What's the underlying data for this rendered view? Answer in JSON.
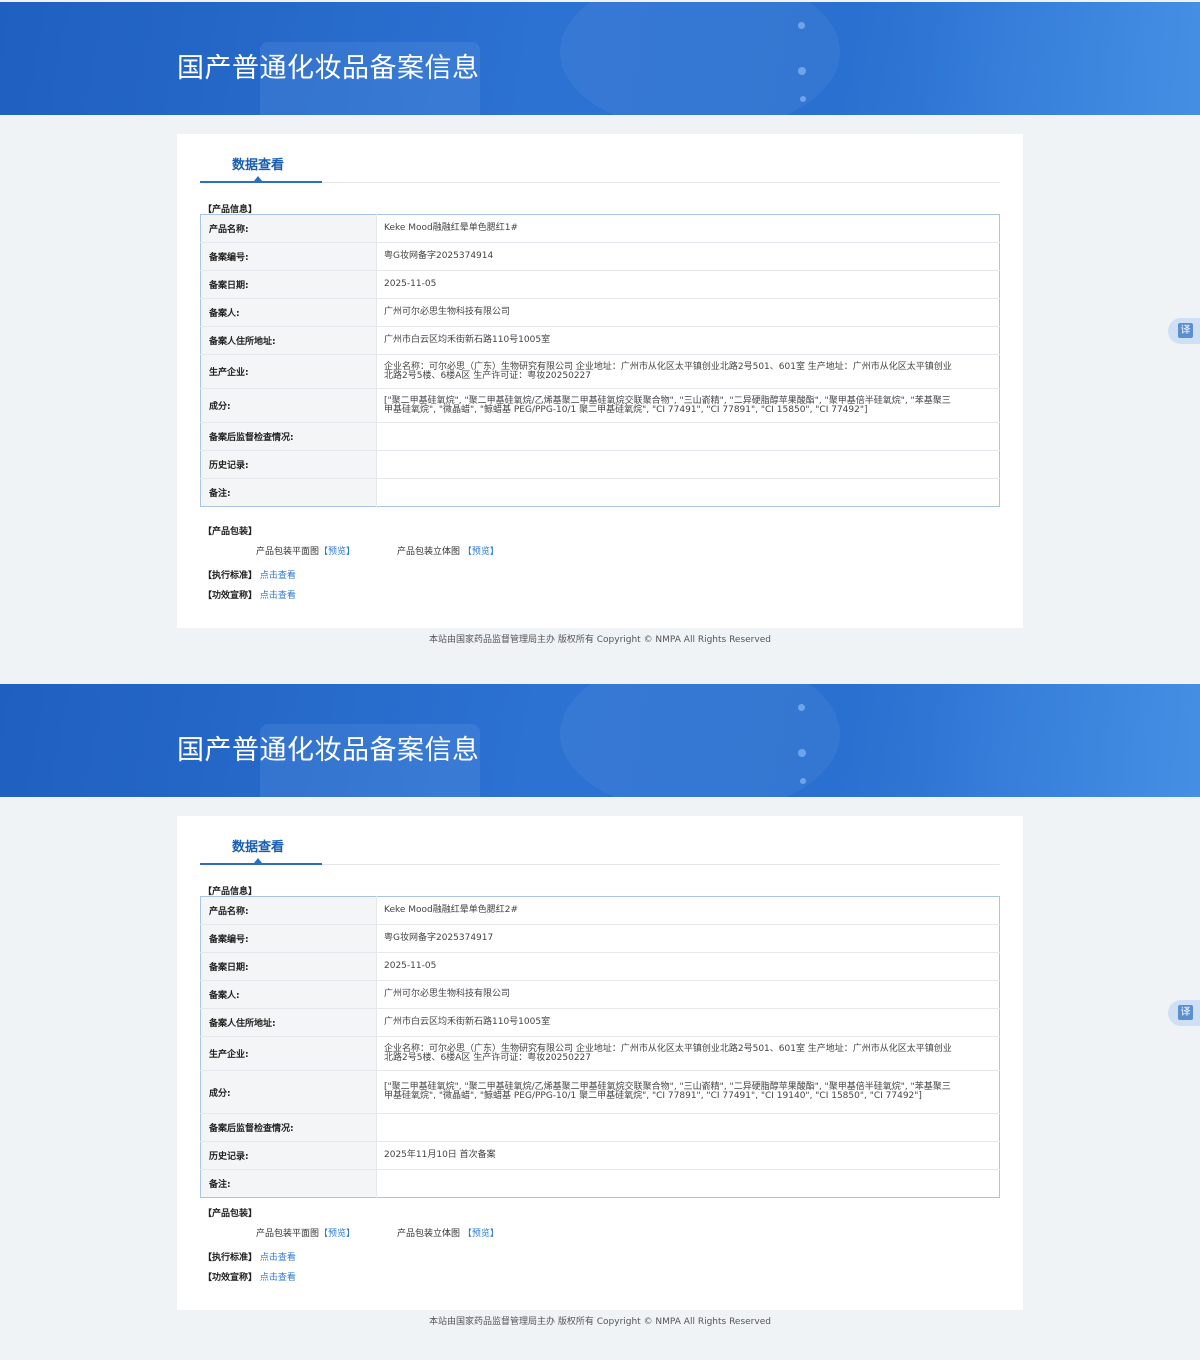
{
  "records": [
    {
      "banner_title": "国产普通化妆品备案信息",
      "tab_label": "数据查看",
      "section_product_info": "【产品信息】",
      "fields": [
        {
          "key": "产品名称:",
          "value": "Keke Mood融融红晕单色腮红1#"
        },
        {
          "key": "备案编号:",
          "value": "粤G妆网备字2025374914"
        },
        {
          "key": "备案日期:",
          "value": "2025-11-05"
        },
        {
          "key": "备案人:",
          "value": "广州可尔必思生物科技有限公司"
        },
        {
          "key": "备案人住所地址:",
          "value": "广州市白云区均禾街新石路110号1005室"
        },
        {
          "key": "生产企业:",
          "value": "企业名称：可尔必思（广东）生物研究有限公司 企业地址：广州市从化区太平镇创业北路2号501、601室 生产地址：广州市从化区太平镇创业北路2号5楼、6楼A区 生产许可证：粤妆20250227"
        },
        {
          "key": "成分:",
          "value": "[\"聚二甲基硅氧烷\", \"聚二甲基硅氧烷/乙烯基聚二甲基硅氧烷交联聚合物\", \"三山嵛精\", \"二异硬脂醇苹果酸酯\", \"聚甲基倍半硅氧烷\", \"苯基聚三甲基硅氧烷\", \"微晶蜡\", \"鲸蜡基 PEG/PPG-10/1 聚二甲基硅氧烷\", \"CI 77491\", \"CI 77891\", \"CI 15850\", \"CI 77492\"]"
        },
        {
          "key": "备案后监督检查情况:",
          "value": ""
        },
        {
          "key": "历史记录:",
          "value": ""
        },
        {
          "key": "备注:",
          "value": ""
        }
      ],
      "section_packaging": "【产品包装】",
      "pkg_flat_label": "产品包装平面图",
      "pkg_flat_link": "【预览】",
      "pkg_3d_label": "产品包装立体图",
      "pkg_3d_link": "【预览】",
      "standard_label": "【执行标准】",
      "standard_link": "点击查看",
      "efficacy_label": "【功效宣称】",
      "efficacy_link": "点击查看",
      "copyright": "本站由国家药品监督管理局主办 版权所有 Copyright © NMPA All Rights Reserved",
      "translate_icon": "译"
    },
    {
      "banner_title": "国产普通化妆品备案信息",
      "tab_label": "数据查看",
      "section_product_info": "【产品信息】",
      "fields": [
        {
          "key": "产品名称:",
          "value": "Keke Mood融融红晕单色腮红2#"
        },
        {
          "key": "备案编号:",
          "value": "粤G妆网备字2025374917"
        },
        {
          "key": "备案日期:",
          "value": "2025-11-05"
        },
        {
          "key": "备案人:",
          "value": "广州可尔必思生物科技有限公司"
        },
        {
          "key": "备案人住所地址:",
          "value": "广州市白云区均禾街新石路110号1005室"
        },
        {
          "key": "生产企业:",
          "value": "企业名称：可尔必思（广东）生物研究有限公司 企业地址：广州市从化区太平镇创业北路2号501、601室 生产地址：广州市从化区太平镇创业北路2号5楼、6楼A区 生产许可证：粤妆20250227"
        },
        {
          "key": "成分:",
          "value": "[\"聚二甲基硅氧烷\", \"聚二甲基硅氧烷/乙烯基聚二甲基硅氧烷交联聚合物\", \"三山嵛精\", \"二异硬脂醇苹果酸酯\", \"聚甲基倍半硅氧烷\", \"苯基聚三甲基硅氧烷\", \"微晶蜡\", \"鲸蜡基 PEG/PPG-10/1 聚二甲基硅氧烷\", \"CI 77891\", \"CI 77491\", \"CI 19140\", \"CI 15850\", \"CI 77492\"]"
        },
        {
          "key": "备案后监督检查情况:",
          "value": ""
        },
        {
          "key": "历史记录:",
          "value": "2025年11月10日 首次备案"
        },
        {
          "key": "备注:",
          "value": ""
        }
      ],
      "section_packaging": "【产品包装】",
      "pkg_flat_label": "产品包装平面图",
      "pkg_flat_link": "【预览】",
      "pkg_3d_label": "产品包装立体图",
      "pkg_3d_link": "【预览】",
      "standard_label": "【执行标准】",
      "standard_link": "点击查看",
      "efficacy_label": "【功效宣称】",
      "efficacy_link": "点击查看",
      "copyright": "本站由国家药品监督管理局主办 版权所有 Copyright © NMPA All Rights Reserved",
      "translate_icon": "译"
    }
  ]
}
